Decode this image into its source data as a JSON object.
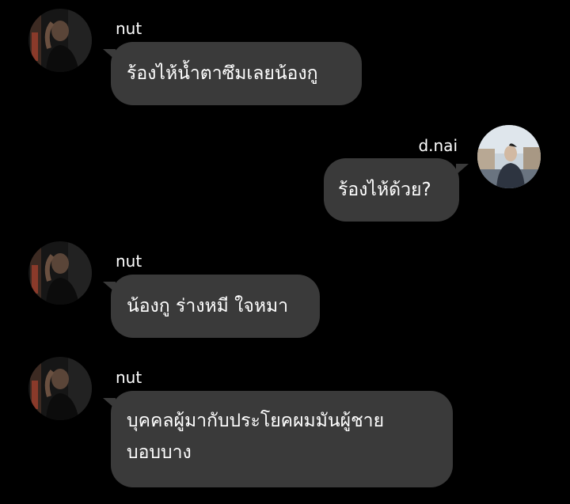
{
  "messages": [
    {
      "sender": "nut",
      "text": "ร้องไห้น้ำตาซึมเลยน้องกู"
    },
    {
      "sender": "d.nai",
      "text": "ร้องไห้ด้วย?"
    },
    {
      "sender": "nut",
      "text": "น้องกู ร่างหมี ใจหมา"
    },
    {
      "sender": "nut",
      "lines": [
        "บุคคลผู้มากับประโยคผมมันผู้ชาย",
        "บอบบาง"
      ]
    }
  ],
  "colors": {
    "background": "#000000",
    "bubble": "#3a3a3a",
    "text": "#ffffff"
  }
}
